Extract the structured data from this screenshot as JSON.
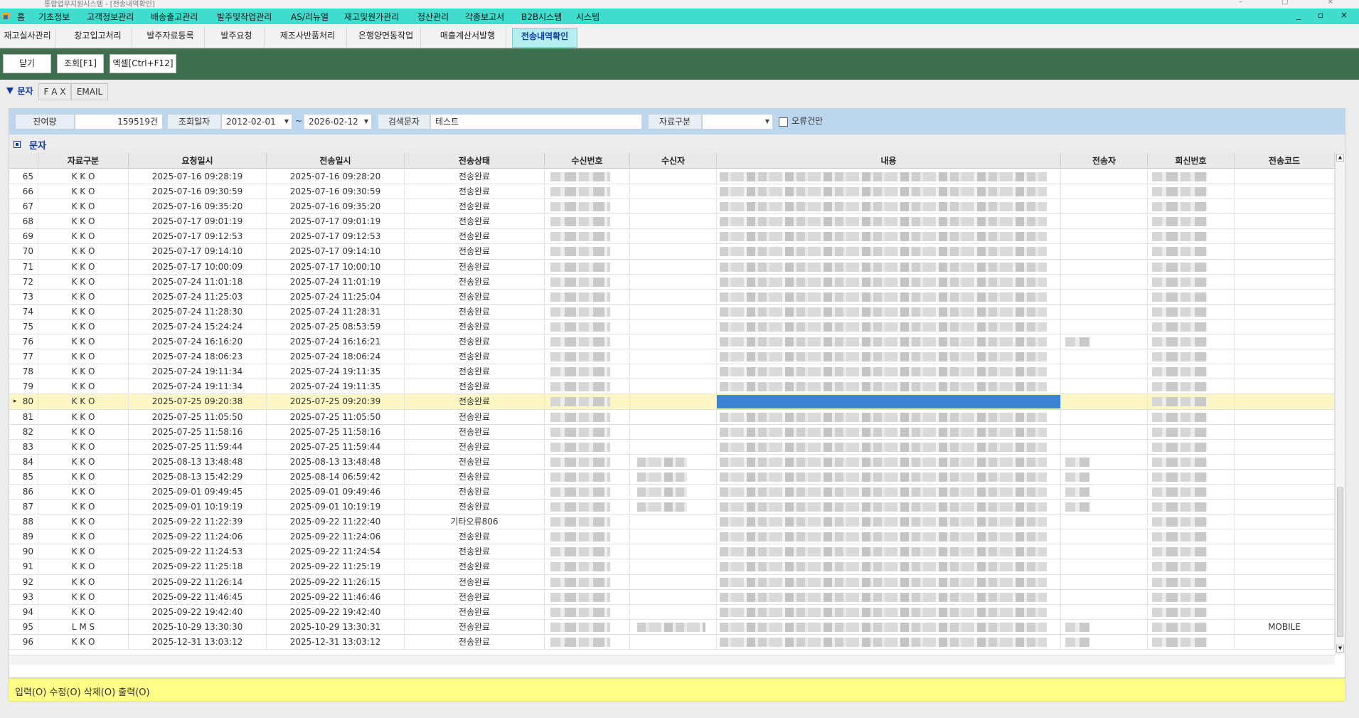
{
  "window": {
    "title": "통합업무지원시스템 - [전송내역확인]"
  },
  "menubar": {
    "items": [
      "홈",
      "기초정보",
      "고객정보관리",
      "배송출고관리",
      "발주및작업관리",
      "AS/리뉴얼",
      "재고및원가관리",
      "정산관리",
      "각종보고서",
      "B2B시스템",
      "시스템"
    ]
  },
  "tabs": [
    "재고실사관리",
    "창고입고처리",
    "발주자료등록",
    "발주요청",
    "제조사반품처리",
    "은행양면동작업",
    "매출계산서발행",
    "전송내역확인"
  ],
  "active_tab": "전송내역확인",
  "toolbar": {
    "close_label": "닫기",
    "search_label": "조회[F1]",
    "excel_label": "엑셀[Ctrl+F12]"
  },
  "subtabs": {
    "sms": "문자",
    "fax": "F A X",
    "email": "EMAIL"
  },
  "search": {
    "balance_label": "잔여량",
    "balance_value": "159519건",
    "date_label": "조회일자",
    "date_from": "2012-02-01",
    "date_to": "2026-02-12",
    "range_sep": "~",
    "keyword_label": "검색문자",
    "keyword_value": "테스트",
    "type_label": "자료구분",
    "type_value": "",
    "error_only_label": "오류건만"
  },
  "section_title": "문자",
  "columns": [
    "자료구분",
    "요청일시",
    "전송일시",
    "전송상태",
    "수신번호",
    "수신자",
    "내용",
    "전송자",
    "회신번호",
    "전송코드"
  ],
  "rows": [
    {
      "no": "65",
      "type": "K K O",
      "req": "2025-07-16 09:28:19",
      "sent": "2025-07-16 09:28:20",
      "status": "전송완료",
      "code": ""
    },
    {
      "no": "66",
      "type": "K K O",
      "req": "2025-07-16 09:30:59",
      "sent": "2025-07-16 09:30:59",
      "status": "전송완료",
      "code": ""
    },
    {
      "no": "67",
      "type": "K K O",
      "req": "2025-07-16 09:35:20",
      "sent": "2025-07-16 09:35:20",
      "status": "전송완료",
      "code": ""
    },
    {
      "no": "68",
      "type": "K K O",
      "req": "2025-07-17 09:01:19",
      "sent": "2025-07-17 09:01:19",
      "status": "전송완료",
      "code": ""
    },
    {
      "no": "69",
      "type": "K K O",
      "req": "2025-07-17 09:12:53",
      "sent": "2025-07-17 09:12:53",
      "status": "전송완료",
      "code": ""
    },
    {
      "no": "70",
      "type": "K K O",
      "req": "2025-07-17 09:14:10",
      "sent": "2025-07-17 09:14:10",
      "status": "전송완료",
      "code": ""
    },
    {
      "no": "71",
      "type": "K K O",
      "req": "2025-07-17 10:00:09",
      "sent": "2025-07-17 10:00:10",
      "status": "전송완료",
      "code": ""
    },
    {
      "no": "72",
      "type": "K K O",
      "req": "2025-07-24 11:01:18",
      "sent": "2025-07-24 11:01:19",
      "status": "전송완료",
      "code": ""
    },
    {
      "no": "73",
      "type": "K K O",
      "req": "2025-07-24 11:25:03",
      "sent": "2025-07-24 11:25:04",
      "status": "전송완료",
      "code": ""
    },
    {
      "no": "74",
      "type": "K K O",
      "req": "2025-07-24 11:28:30",
      "sent": "2025-07-24 11:28:31",
      "status": "전송완료",
      "code": ""
    },
    {
      "no": "75",
      "type": "K K O",
      "req": "2025-07-24 15:24:24",
      "sent": "2025-07-25 08:53:59",
      "status": "전송완료",
      "code": ""
    },
    {
      "no": "76",
      "type": "K K O",
      "req": "2025-07-24 16:16:20",
      "sent": "2025-07-24 16:16:21",
      "status": "전송완료",
      "code": ""
    },
    {
      "no": "77",
      "type": "K K O",
      "req": "2025-07-24 18:06:23",
      "sent": "2025-07-24 18:06:24",
      "status": "전송완료",
      "code": ""
    },
    {
      "no": "78",
      "type": "K K O",
      "req": "2025-07-24 19:11:34",
      "sent": "2025-07-24 19:11:35",
      "status": "전송완료",
      "code": ""
    },
    {
      "no": "79",
      "type": "K K O",
      "req": "2025-07-24 19:11:34",
      "sent": "2025-07-24 19:11:35",
      "status": "전송완료",
      "code": ""
    },
    {
      "no": "80",
      "type": "K K O",
      "req": "2025-07-25 09:20:38",
      "sent": "2025-07-25 09:20:39",
      "status": "전송완료",
      "code": "",
      "selected": true
    },
    {
      "no": "81",
      "type": "K K O",
      "req": "2025-07-25 11:05:50",
      "sent": "2025-07-25 11:05:50",
      "status": "전송완료",
      "code": ""
    },
    {
      "no": "82",
      "type": "K K O",
      "req": "2025-07-25 11:58:16",
      "sent": "2025-07-25 11:58:16",
      "status": "전송완료",
      "code": ""
    },
    {
      "no": "83",
      "type": "K K O",
      "req": "2025-07-25 11:59:44",
      "sent": "2025-07-25 11:59:44",
      "status": "전송완료",
      "code": ""
    },
    {
      "no": "84",
      "type": "K K O",
      "req": "2025-08-13 13:48:48",
      "sent": "2025-08-13 13:48:48",
      "status": "전송완료",
      "code": ""
    },
    {
      "no": "85",
      "type": "K K O",
      "req": "2025-08-13 15:42:29",
      "sent": "2025-08-14 06:59:42",
      "status": "전송완료",
      "code": ""
    },
    {
      "no": "86",
      "type": "K K O",
      "req": "2025-09-01 09:49:45",
      "sent": "2025-09-01 09:49:46",
      "status": "전송완료",
      "code": ""
    },
    {
      "no": "87",
      "type": "K K O",
      "req": "2025-09-01 10:19:19",
      "sent": "2025-09-01 10:19:19",
      "status": "전송완료",
      "code": ""
    },
    {
      "no": "88",
      "type": "K K O",
      "req": "2025-09-22 11:22:39",
      "sent": "2025-09-22 11:22:40",
      "status": "기타오류806",
      "code": ""
    },
    {
      "no": "89",
      "type": "K K O",
      "req": "2025-09-22 11:24:06",
      "sent": "2025-09-22 11:24:06",
      "status": "전송완료",
      "code": ""
    },
    {
      "no": "90",
      "type": "K K O",
      "req": "2025-09-22 11:24:53",
      "sent": "2025-09-22 11:24:54",
      "status": "전송완료",
      "code": ""
    },
    {
      "no": "91",
      "type": "K K O",
      "req": "2025-09-22 11:25:18",
      "sent": "2025-09-22 11:25:19",
      "status": "전송완료",
      "code": ""
    },
    {
      "no": "92",
      "type": "K K O",
      "req": "2025-09-22 11:26:14",
      "sent": "2025-09-22 11:26:15",
      "status": "전송완료",
      "code": ""
    },
    {
      "no": "93",
      "type": "K K O",
      "req": "2025-09-22 11:46:45",
      "sent": "2025-09-22 11:46:46",
      "status": "전송완료",
      "code": ""
    },
    {
      "no": "94",
      "type": "K K O",
      "req": "2025-09-22 19:42:40",
      "sent": "2025-09-22 19:42:40",
      "status": "전송완료",
      "code": ""
    },
    {
      "no": "95",
      "type": "L M S",
      "req": "2025-10-29 13:30:30",
      "sent": "2025-10-29 13:30:31",
      "status": "전송완료",
      "code": "MOBILE"
    },
    {
      "no": "96",
      "type": "K K O",
      "req": "2025-12-31 13:03:12",
      "sent": "2025-12-31 13:03:12",
      "status": "전송완료",
      "code": ""
    }
  ],
  "footer_text": "입력(O) 수정(O) 삭제(O) 출력(O)",
  "colors": {
    "menubar": "#40dccd",
    "toolbar": "#3f6f4f",
    "active_tab": "#b6eef0",
    "search_bar": "#bcd6ee",
    "selected_row": "#fbf6c3",
    "selected_cell": "#3c82d6",
    "footer": "#fdfd88"
  },
  "icons": {
    "home": "home-icon",
    "section": "section-icon"
  }
}
